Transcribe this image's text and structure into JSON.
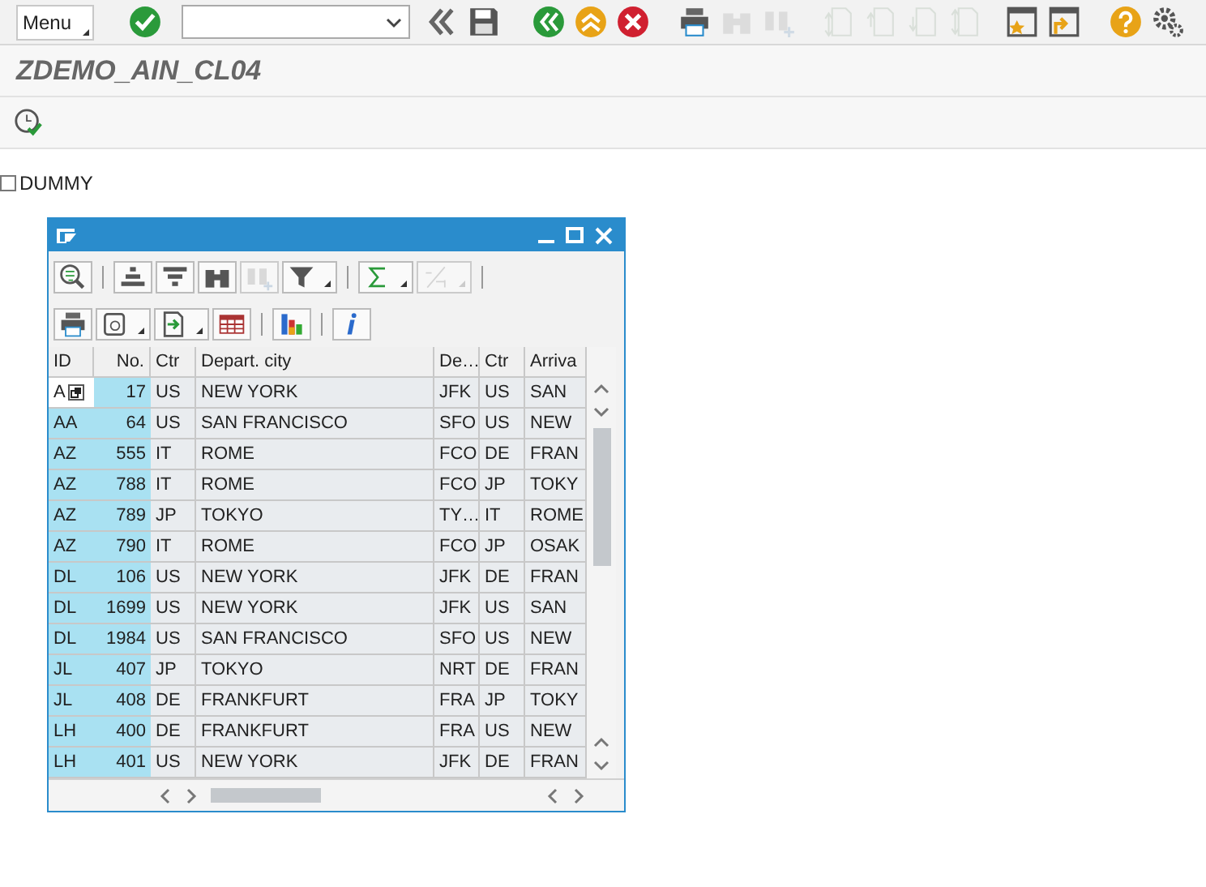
{
  "system_toolbar": {
    "menu_button": "Menu",
    "buttons": [
      {
        "kind": "enter",
        "disabled": false
      },
      {
        "kind": "command-field",
        "disabled": false
      },
      {
        "kind": "collapse",
        "disabled": false
      },
      {
        "kind": "save",
        "disabled": false
      },
      {
        "kind": "back",
        "disabled": false
      },
      {
        "kind": "exit",
        "disabled": false
      },
      {
        "kind": "cancel",
        "disabled": false
      },
      {
        "kind": "print",
        "disabled": false
      },
      {
        "kind": "find",
        "disabled": true
      },
      {
        "kind": "find-next",
        "disabled": true
      },
      {
        "kind": "first-page",
        "disabled": true
      },
      {
        "kind": "previous-page",
        "disabled": true
      },
      {
        "kind": "next-page",
        "disabled": true
      },
      {
        "kind": "last-page",
        "disabled": true
      },
      {
        "kind": "new-session",
        "disabled": false
      },
      {
        "kind": "shortcut",
        "disabled": false
      },
      {
        "kind": "help",
        "disabled": false
      },
      {
        "kind": "settings",
        "disabled": false
      }
    ]
  },
  "title": "ZDEMO_AIN_CL04",
  "application_toolbar": [
    {
      "kind": "execute"
    }
  ],
  "checkbox": {
    "label": "DUMMY",
    "checked": false
  },
  "popup": {
    "toolbar_rows": [
      [
        {
          "kind": "details",
          "disabled": false,
          "dropdown": false
        },
        {
          "kind": "separator"
        },
        {
          "kind": "sort-ascending",
          "disabled": false,
          "dropdown": false
        },
        {
          "kind": "sort-descending",
          "disabled": false,
          "dropdown": false
        },
        {
          "kind": "find",
          "disabled": false,
          "dropdown": false
        },
        {
          "kind": "find-next",
          "disabled": true,
          "dropdown": false
        },
        {
          "kind": "filter",
          "disabled": false,
          "dropdown": true
        },
        {
          "kind": "separator"
        },
        {
          "kind": "sum",
          "disabled": false,
          "dropdown": true
        },
        {
          "kind": "subtotal",
          "disabled": true,
          "dropdown": true
        },
        {
          "kind": "separator"
        }
      ],
      [
        {
          "kind": "print",
          "disabled": false,
          "dropdown": false
        },
        {
          "kind": "views",
          "disabled": false,
          "dropdown": true
        },
        {
          "kind": "export",
          "disabled": false,
          "dropdown": true
        },
        {
          "kind": "layout",
          "disabled": false,
          "dropdown": false
        },
        {
          "kind": "separator"
        },
        {
          "kind": "graphic",
          "disabled": false,
          "dropdown": false
        },
        {
          "kind": "separator"
        },
        {
          "kind": "info",
          "disabled": false,
          "dropdown": false
        }
      ]
    ],
    "table": {
      "columns": [
        {
          "label": "ID",
          "key": true
        },
        {
          "label": "No.",
          "key": true
        },
        {
          "label": "Ctr",
          "key": false
        },
        {
          "label": "Depart. city",
          "key": false
        },
        {
          "label": "De…",
          "key": false
        },
        {
          "label": "Ctr",
          "key": false
        },
        {
          "label": "Arriva",
          "key": false
        }
      ],
      "rows": [
        {
          "focused": true,
          "cells": [
            "A",
            "17",
            "US",
            "NEW YORK",
            "JFK",
            "US",
            "SAN"
          ]
        },
        {
          "focused": false,
          "cells": [
            "AA",
            "64",
            "US",
            "SAN FRANCISCO",
            "SFO",
            "US",
            "NEW"
          ]
        },
        {
          "focused": false,
          "cells": [
            "AZ",
            "555",
            "IT",
            "ROME",
            "FCO",
            "DE",
            "FRAN"
          ]
        },
        {
          "focused": false,
          "cells": [
            "AZ",
            "788",
            "IT",
            "ROME",
            "FCO",
            "JP",
            "TOKY"
          ]
        },
        {
          "focused": false,
          "cells": [
            "AZ",
            "789",
            "JP",
            "TOKYO",
            "TY…",
            "IT",
            "ROME"
          ]
        },
        {
          "focused": false,
          "cells": [
            "AZ",
            "790",
            "IT",
            "ROME",
            "FCO",
            "JP",
            "OSAK"
          ]
        },
        {
          "focused": false,
          "cells": [
            "DL",
            "106",
            "US",
            "NEW YORK",
            "JFK",
            "DE",
            "FRAN"
          ]
        },
        {
          "focused": false,
          "cells": [
            "DL",
            "1699",
            "US",
            "NEW YORK",
            "JFK",
            "US",
            "SAN"
          ]
        },
        {
          "focused": false,
          "cells": [
            "DL",
            "1984",
            "US",
            "SAN FRANCISCO",
            "SFO",
            "US",
            "NEW"
          ]
        },
        {
          "focused": false,
          "cells": [
            "JL",
            "407",
            "JP",
            "TOKYO",
            "NRT",
            "DE",
            "FRAN"
          ]
        },
        {
          "focused": false,
          "cells": [
            "JL",
            "408",
            "DE",
            "FRANKFURT",
            "FRA",
            "JP",
            "TOKY"
          ]
        },
        {
          "focused": false,
          "cells": [
            "LH",
            "400",
            "DE",
            "FRANKFURT",
            "FRA",
            "US",
            "NEW"
          ]
        },
        {
          "focused": false,
          "cells": [
            "LH",
            "401",
            "US",
            "NEW YORK",
            "JFK",
            "DE",
            "FRAN"
          ]
        }
      ]
    }
  }
}
